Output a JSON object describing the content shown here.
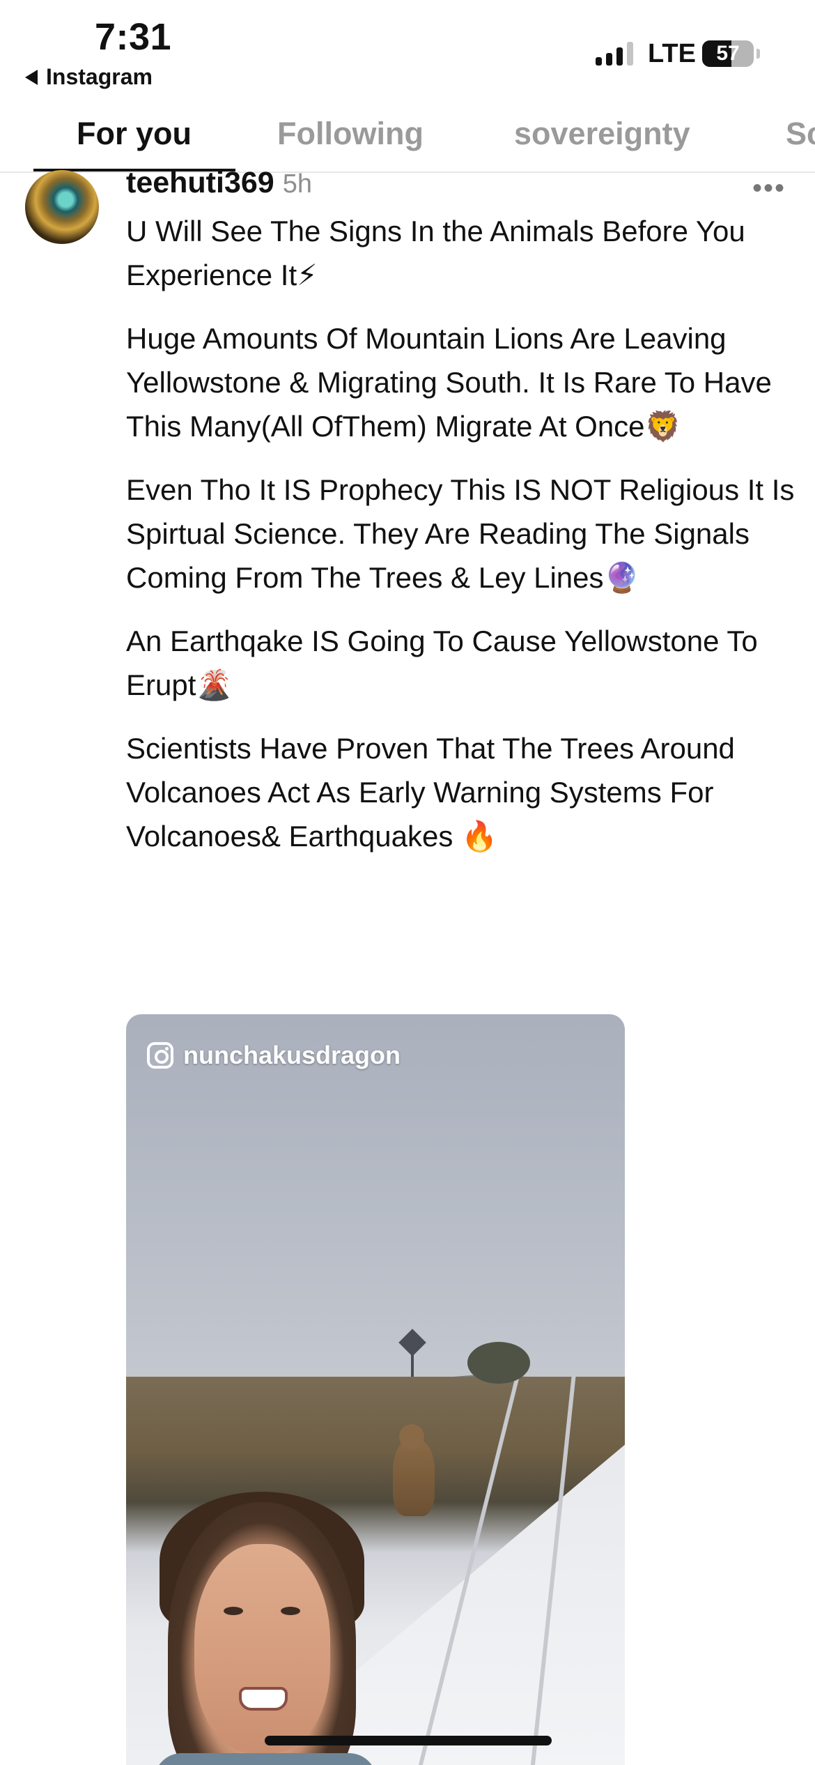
{
  "status_bar": {
    "time": "7:31",
    "back_app_label": "Instagram",
    "network": "LTE",
    "battery_level": "57",
    "battery_fraction": 0.57
  },
  "tabs": [
    {
      "label": "For you",
      "active": true
    },
    {
      "label": "Following",
      "active": false
    },
    {
      "label": "sovereignty",
      "active": false
    },
    {
      "label": "Sc",
      "active": false
    }
  ],
  "post": {
    "username": "teehuti369",
    "time_ago": "5h",
    "more_icon": "ellipsis-icon",
    "caption": [
      "U Will See The Signs In the Animals Before You Experience It⚡",
      "Huge Amounts Of Mountain Lions Are Leaving Yellowstone & Migrating South. It Is Rare To Have This Many(All OfThem) Migrate At Once🦁",
      "Even Tho It IS Prophecy This IS NOT Religious It Is Spirtual Science. They Are Reading The Signals Coming From The Trees & Ley Lines🔮",
      "An Earthqake IS Going To Cause Yellowstone To Erupt🌋",
      "Scientists Have Proven That The Trees Around Volcanoes Act As Early Warning Systems For Volcanoes& Earthquakes 🔥"
    ],
    "media": {
      "watermark_handle": "nunchakusdragon",
      "watermark_icon": "instagram-icon"
    }
  },
  "colors": {
    "text": "#111111",
    "muted": "#8e8e8e",
    "tab_inactive": "#9a9a9a",
    "divider": "#e6e6e6"
  }
}
